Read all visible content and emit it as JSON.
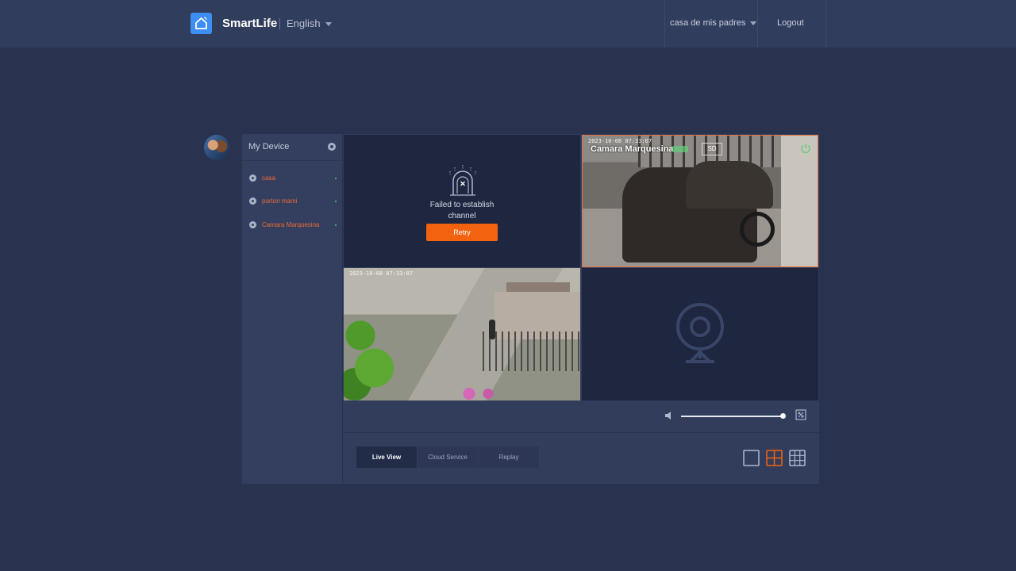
{
  "header": {
    "brand": "SmartLife",
    "language": "English",
    "home": "casa de mis padres",
    "logout": "Logout"
  },
  "sidebar": {
    "title": "My Device",
    "devices": [
      {
        "name": "casa",
        "status_color": "#3fd07d"
      },
      {
        "name": "porton mami",
        "status_color": "#3fd07d"
      },
      {
        "name": "Camara Marquesina",
        "status_color": "#3fd07d"
      }
    ]
  },
  "grid": {
    "cell1": {
      "message": "Failed to establish channel",
      "retry_label": "Retry"
    },
    "cell2": {
      "camera_name": "Camara Marquesina",
      "timestamp": "2023-10-08 07:33:07",
      "quality": "SD"
    },
    "cell3": {
      "timestamp": "2023-10-08 07:33:07"
    }
  },
  "controls": {
    "volume": 0.98,
    "tabs": [
      {
        "label": "Live View",
        "active": true
      },
      {
        "label": "Cloud Service",
        "active": false
      },
      {
        "label": "Replay",
        "active": false
      }
    ],
    "layouts": [
      "single-view-icon",
      "quad-view-icon",
      "nine-view-icon"
    ],
    "active_layout": "quad-view-icon"
  },
  "colors": {
    "accent": "#f2620f",
    "online": "#3fd07d",
    "brand": "#3d8ef2"
  }
}
